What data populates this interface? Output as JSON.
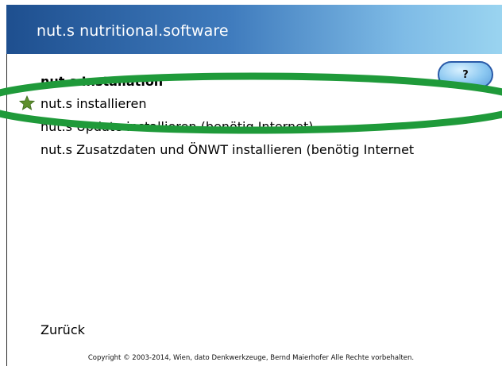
{
  "app": {
    "title": "nut.s nutritional.software"
  },
  "help_button": {
    "label": "?"
  },
  "section": {
    "heading": "nut.s Installation"
  },
  "menu": {
    "items": [
      {
        "label": "nut.s installieren"
      },
      {
        "label": "nut.s Update installieren (benötig Internet)"
      },
      {
        "label": "nut.s Zusatzdaten und ÖNWT installieren  (benötig Internet"
      }
    ]
  },
  "navigation": {
    "back_label": "Zurück"
  },
  "footer": {
    "copyright": "Copyright © 2003-2014, Wien, dato Denkwerkzeuge, Bernd Maierhofer Alle Rechte vorbehalten."
  },
  "icons": {
    "selected_item": "star-icon"
  },
  "colors": {
    "header_start": "#1e4f8f",
    "header_end": "#9ad4f0",
    "annotation": "#1f9a3a",
    "star": "#5e8f2e"
  }
}
